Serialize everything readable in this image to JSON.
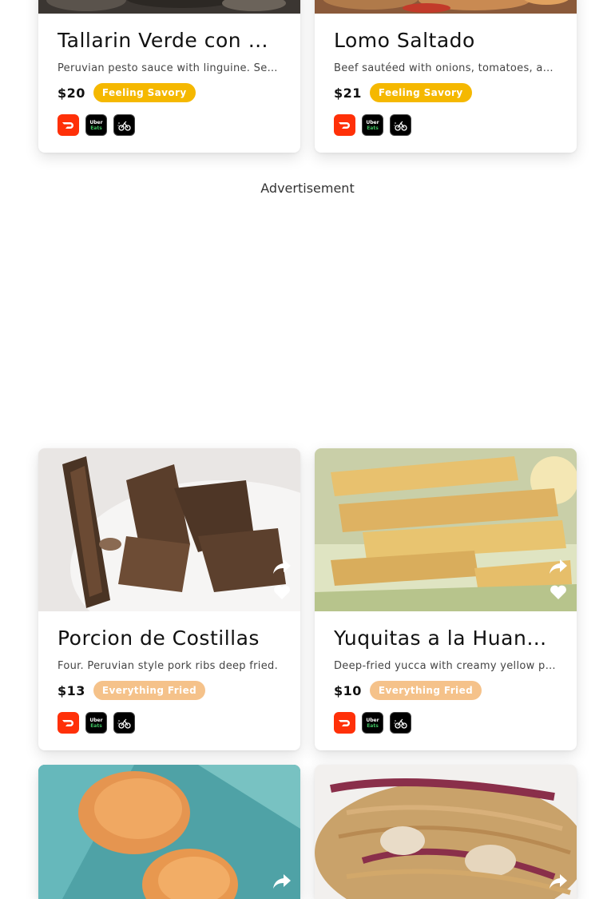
{
  "advertisement_label": "Advertisement",
  "colors": {
    "savory_tag": "#f5b800",
    "fried_tag": "#f5c28a",
    "doordash": "#ff3008",
    "ubereats_green": "#3fc060"
  },
  "delivery_icons": [
    "doordash-icon",
    "uber-eats-icon",
    "postmates-icon"
  ],
  "action_icons": [
    "share-icon",
    "heart-icon"
  ],
  "ubereats_text": {
    "line1": "Uber",
    "line2": "Eats"
  },
  "menu": [
    {
      "title": "Tallarin Verde con Bi…",
      "description": "Peruvian pesto sauce with linguine. Serv…",
      "price": "$20",
      "tag": "Feeling Savory"
    },
    {
      "title": "Lomo Saltado",
      "description": "Beef sautéed with onions, tomatoes, and …",
      "price": "$21",
      "tag": "Feeling Savory"
    },
    {
      "title": "Porcion de Costillas",
      "description": "Four. Peruvian style pork ribs deep fried.",
      "price": "$13",
      "tag": "Everything Fried"
    },
    {
      "title": "Yuquitas a la Huanc…",
      "description": "Deep-fried yucca with creamy yellow pep…",
      "price": "$10",
      "tag": "Everything Fried"
    }
  ]
}
